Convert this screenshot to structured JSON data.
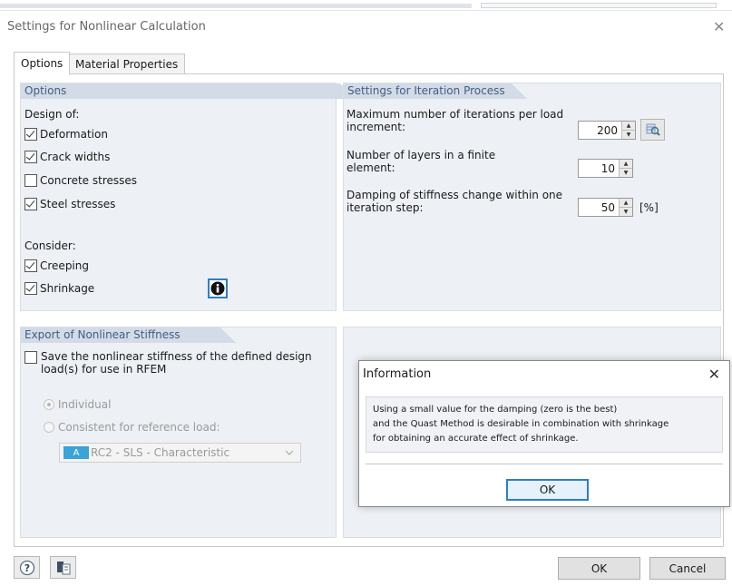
{
  "window": {
    "title": "Settings for Nonlinear Calculation",
    "close_glyph": "✕"
  },
  "tabs": [
    {
      "label": "Options",
      "active": true
    },
    {
      "label": "Material Properties",
      "active": false
    }
  ],
  "options_panel": {
    "header": "Options",
    "design_label": "Design of:",
    "design_items": [
      {
        "label": "Deformation",
        "checked": true
      },
      {
        "label": "Crack widths",
        "checked": true
      },
      {
        "label": "Concrete stresses",
        "checked": false
      },
      {
        "label": "Steel stresses",
        "checked": true
      }
    ],
    "consider_label": "Consider:",
    "consider_items": [
      {
        "label": "Creeping",
        "checked": true
      },
      {
        "label": "Shrinkage",
        "checked": true
      }
    ],
    "info_icon": "info-icon"
  },
  "iteration_panel": {
    "header": "Settings for Iteration Process",
    "max_iter_label_1": "Maximum number of iterations per load",
    "max_iter_label_2": "increment:",
    "max_iter_value": "200",
    "layers_label_1": "Number of layers in a finite",
    "layers_label_2": "element:",
    "layers_value": "10",
    "damping_label_1": "Damping of stiffness change within one",
    "damping_label_2": "iteration step:",
    "damping_value": "50",
    "damping_unit": "[%]"
  },
  "export_panel": {
    "header": "Export of Nonlinear Stiffness",
    "save_label_1": "Save the nonlinear stiffness of the defined design",
    "save_label_2": "load(s) for use in RFEM",
    "save_checked": false,
    "radio_individual": "Individual",
    "radio_consistent": "Consistent for reference load:",
    "load_badge": "A",
    "load_value": "RC2 - SLS - Characteristic"
  },
  "info_dialog": {
    "title": "Information",
    "close_glyph": "✕",
    "message_1": "Using a small value for the damping (zero is the best)",
    "message_2": "and the Quast Method is desirable in combination with shrinkage",
    "message_3": "for obtaining an accurate effect of shrinkage.",
    "ok_label": "OK"
  },
  "footer": {
    "ok_label": "OK",
    "cancel_label": "Cancel",
    "help_icon": "help-icon",
    "report_icon": "report-icon"
  },
  "colors": {
    "panel_bg": "#edf0f4",
    "panel_header_bg": "#d3dbe6",
    "panel_header_text": "#3f5f86",
    "accent_blue": "#2d7fc4"
  }
}
